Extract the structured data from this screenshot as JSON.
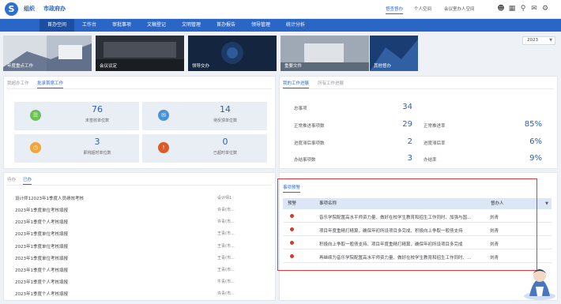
{
  "header": {
    "org": "组织",
    "office": "市政府办",
    "links": [
      "督查督办",
      "个人空间",
      "会议室办人空间"
    ],
    "icons": [
      "user-icon",
      "grid-icon",
      "search-icon",
      "chat-icon",
      "gear-icon"
    ]
  },
  "nav": {
    "items": [
      "首办空间",
      "工作台",
      "审批事项",
      "文稿登记",
      "文明管理",
      "首办报告",
      "领导管理",
      "统计分析"
    ],
    "active_index": 0
  },
  "year": "2023",
  "banners": [
    "年度重点工作",
    "会议议定",
    "领导交办",
    "重要文件",
    "其他督办"
  ],
  "handle": {
    "tabs": [
      "我超办工作",
      "批承首席工作"
    ],
    "active_tab": 1,
    "cards": [
      {
        "value": "76",
        "label": "未签收单位数",
        "color": "#6cbf59",
        "icon": "table-icon"
      },
      {
        "value": "14",
        "label": "待反馈单位数",
        "color": "#4a92d6",
        "icon": "message-icon"
      },
      {
        "value": "3",
        "label": "即将超时单位数",
        "color": "#f0a53a",
        "icon": "clock-icon"
      },
      {
        "value": "0",
        "label": "已超时单位数",
        "color": "#db5b29",
        "icon": "alert-icon"
      }
    ]
  },
  "progress": {
    "tabs": [
      "我的工作进展",
      "所有工作进展"
    ],
    "active_tab": 0,
    "total_label": "总事项",
    "total_value": "34",
    "rows": [
      {
        "label": "正常推进事项数",
        "value": "29",
        "rlabel": "正常推进率",
        "rvalue": "85%"
      },
      {
        "label": "进度滞后事项数",
        "value": "2",
        "rlabel": "进度滞后率",
        "rvalue": "6%"
      },
      {
        "label": "办结事项数",
        "value": "3",
        "rlabel": "办结率",
        "rvalue": "9%"
      }
    ]
  },
  "todo": {
    "tabs": [
      "待办",
      "已办"
    ],
    "active_tab": 1,
    "items": [
      {
        "text": "设计师12023年1季度人员绩效考核",
        "right": "设计师1"
      },
      {
        "text": "2023年1季度单位考核填报",
        "right": "许青(市..."
      },
      {
        "text": "2023年1季度个人考核填报",
        "right": "许青(市..."
      },
      {
        "text": "2023年1季度单位考核填报",
        "right": "王青(市..."
      },
      {
        "text": "2023年1季度单位考核填报",
        "right": "王青(市..."
      },
      {
        "text": "2023年1季度单位考核填报",
        "right": "王青(市..."
      },
      {
        "text": "2023年1季度个人考核填报",
        "right": "王青(市..."
      },
      {
        "text": "2023年1季度个人考核填报",
        "right": "牛青(市..."
      },
      {
        "text": "2023年1季度个人考核填报",
        "right": "许青(市..."
      }
    ]
  },
  "warning": {
    "tab": "事项预警",
    "columns": [
      "预警",
      "事项名称",
      "督办人"
    ],
    "rows": [
      {
        "name": "音乐学院配置高水平师资力量、做好在校学生教育和招生工作同时、加强与国...",
        "who": "刘青"
      },
      {
        "name": "项目年度重精打精算，确保年初所设项目多完成、积极向上争取一般债支持",
        "who": "刘青"
      },
      {
        "name": "积极向上争取一般债支持、项目年度重精打精算，确保年初所设项目多完成",
        "who": "刘青"
      },
      {
        "name": "再继续为音乐学院配置高水平师资力量、做好在校学生教育和招生工作同时、...",
        "who": "刘青"
      }
    ]
  },
  "colors": {
    "primary": "#2a66c6",
    "nav_active": "#1c4fa3",
    "warning_frame": "#e33b3b",
    "alert_dot": "#d73a2d"
  }
}
